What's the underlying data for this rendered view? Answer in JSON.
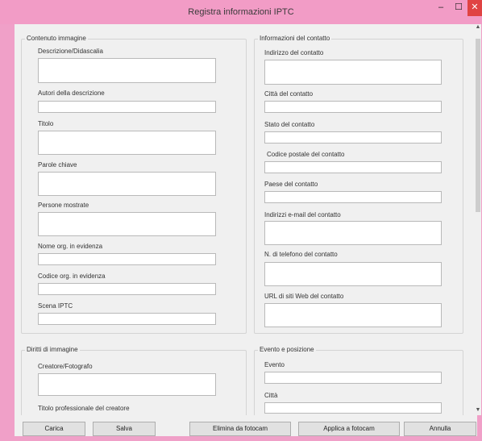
{
  "window": {
    "title": "Registra informazioni IPTC",
    "minimize": "–",
    "maximize": "☐",
    "close": "✕"
  },
  "groups": {
    "image_content": {
      "title": "Contenuto immagine",
      "labels": [
        "Descrizione/Didascalia",
        "Autori della descrizione",
        "Titolo",
        "Parole chiave",
        "Persone mostrate",
        "Nome org. in evidenza",
        "Codice org. in evidenza",
        "Scena IPTC"
      ]
    },
    "contact_info": {
      "title": "Informazioni del contatto",
      "labels": [
        "Indirizzo del contatto",
        "Città del contatto",
        "Stato del contatto",
        "Codice postale del contatto",
        "Paese del contatto",
        "Indirizzi e-mail del contatto",
        "N. di telefono del contatto",
        "URL di siti Web del contatto"
      ]
    },
    "image_rights": {
      "title": "Diritti di immagine",
      "labels": [
        "Creatore/Fotografo",
        "Titolo professionale del creatore"
      ]
    },
    "event_location": {
      "title": "Evento e posizione",
      "labels": [
        "Evento",
        "Città"
      ]
    }
  },
  "footer": {
    "load": "Carica",
    "save": "Salva",
    "delete_camera": "Elimina da fotocam",
    "apply_camera": "Applica a fotocam",
    "cancel": "Annulla"
  },
  "scrollbar": {
    "up": "▲",
    "down": "▼"
  }
}
